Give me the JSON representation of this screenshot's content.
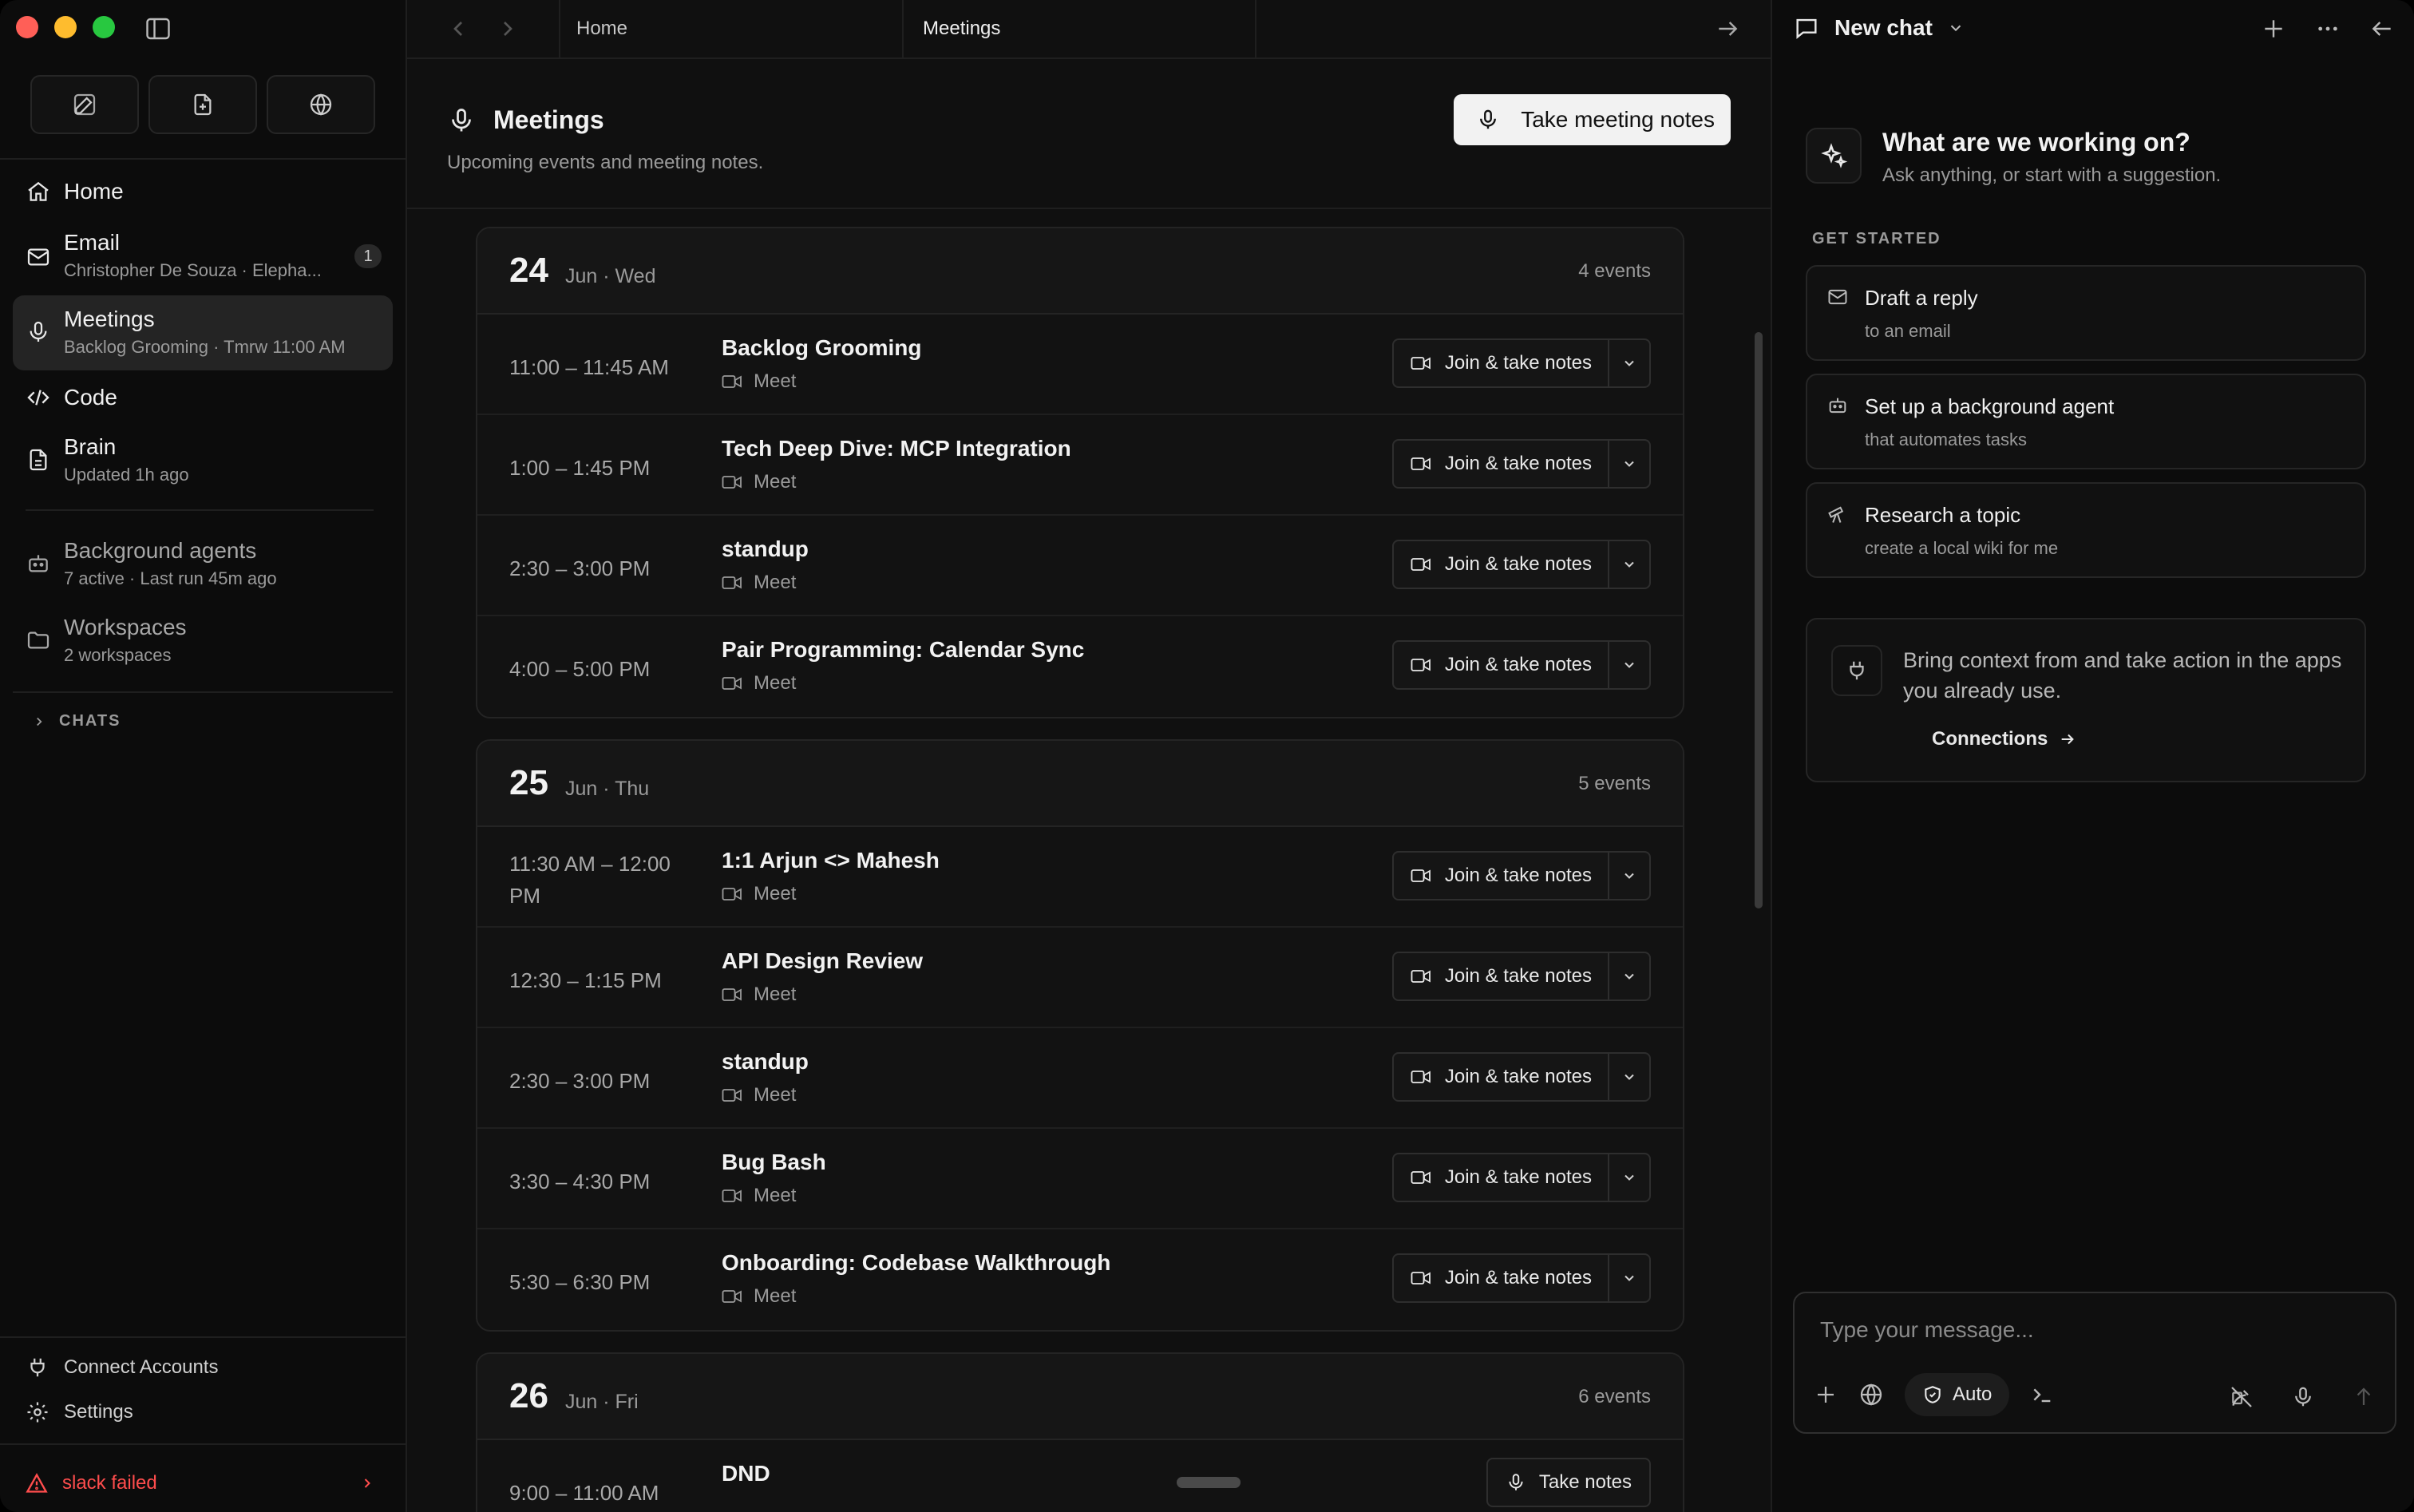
{
  "sidebar": {
    "nav": [
      {
        "label": "Home",
        "sub": ""
      },
      {
        "label": "Email",
        "sub": "Christopher De Souza · Elepha...",
        "badge": "1"
      },
      {
        "label": "Meetings",
        "sub": "Backlog Grooming · Tmrw 11:00 AM"
      },
      {
        "label": "Code",
        "sub": ""
      },
      {
        "label": "Brain",
        "sub": "Updated 1h ago"
      },
      {
        "label": "Background agents",
        "sub": "7 active · Last run 45m ago"
      },
      {
        "label": "Workspaces",
        "sub": "2 workspaces"
      }
    ],
    "chats_label": "CHATS",
    "connect_label": "Connect Accounts",
    "settings_label": "Settings",
    "error_label": "slack failed"
  },
  "tabs": {
    "home": "Home",
    "meetings": "Meetings"
  },
  "page": {
    "title": "Meetings",
    "subtitle": "Upcoming events and meeting notes.",
    "primary_action": "Take meeting notes"
  },
  "days": [
    {
      "num": "24",
      "date": "Jun · Wed",
      "count": "4 events",
      "events": [
        {
          "time": "11:00 – 11:45 AM",
          "title": "Backlog Grooming",
          "meta": "Meet",
          "action": "Join & take notes"
        },
        {
          "time": "1:00 – 1:45 PM",
          "title": "Tech Deep Dive: MCP Integration",
          "meta": "Meet",
          "action": "Join & take notes"
        },
        {
          "time": "2:30 – 3:00 PM",
          "title": "standup",
          "meta": "Meet",
          "action": "Join & take notes"
        },
        {
          "time": "4:00 – 5:00 PM",
          "title": "Pair Programming: Calendar Sync",
          "meta": "Meet",
          "action": "Join & take notes"
        }
      ]
    },
    {
      "num": "25",
      "date": "Jun · Thu",
      "count": "5 events",
      "events": [
        {
          "time": "11:30 AM – 12:00 PM",
          "title": "1:1 Arjun <> Mahesh",
          "meta": "Meet",
          "action": "Join & take notes"
        },
        {
          "time": "12:30 – 1:15 PM",
          "title": "API Design Review",
          "meta": "Meet",
          "action": "Join & take notes"
        },
        {
          "time": "2:30 – 3:00 PM",
          "title": "standup",
          "meta": "Meet",
          "action": "Join & take notes"
        },
        {
          "time": "3:30 – 4:30 PM",
          "title": "Bug Bash",
          "meta": "Meet",
          "action": "Join & take notes"
        },
        {
          "time": "5:30 – 6:30 PM",
          "title": "Onboarding: Codebase Walkthrough",
          "meta": "Meet",
          "action": "Join & take notes"
        }
      ]
    },
    {
      "num": "26",
      "date": "Jun · Fri",
      "count": "6 events",
      "events": [
        {
          "time": "9:00 – 11:00 AM",
          "title": "DND",
          "meta": "",
          "action": "Take notes"
        }
      ]
    }
  ],
  "chat": {
    "title": "New chat",
    "hero_title": "What are we working on?",
    "hero_sub": "Ask anything, or start with a suggestion.",
    "get_started": "GET STARTED",
    "suggestions": [
      {
        "title": "Draft a reply",
        "sub": "to an email"
      },
      {
        "title": "Set up a background agent",
        "sub": "that automates tasks"
      },
      {
        "title": "Research a topic",
        "sub": "create a local wiki for me"
      }
    ],
    "connections_text": "Bring context from and take action in the apps you already use.",
    "connections_link": "Connections",
    "input_placeholder": "Type your message...",
    "mode_label": "Auto"
  },
  "colors": {
    "error": "#ff4d4d",
    "active_nav": "#242424",
    "primary_button": "#f2f2f2"
  }
}
